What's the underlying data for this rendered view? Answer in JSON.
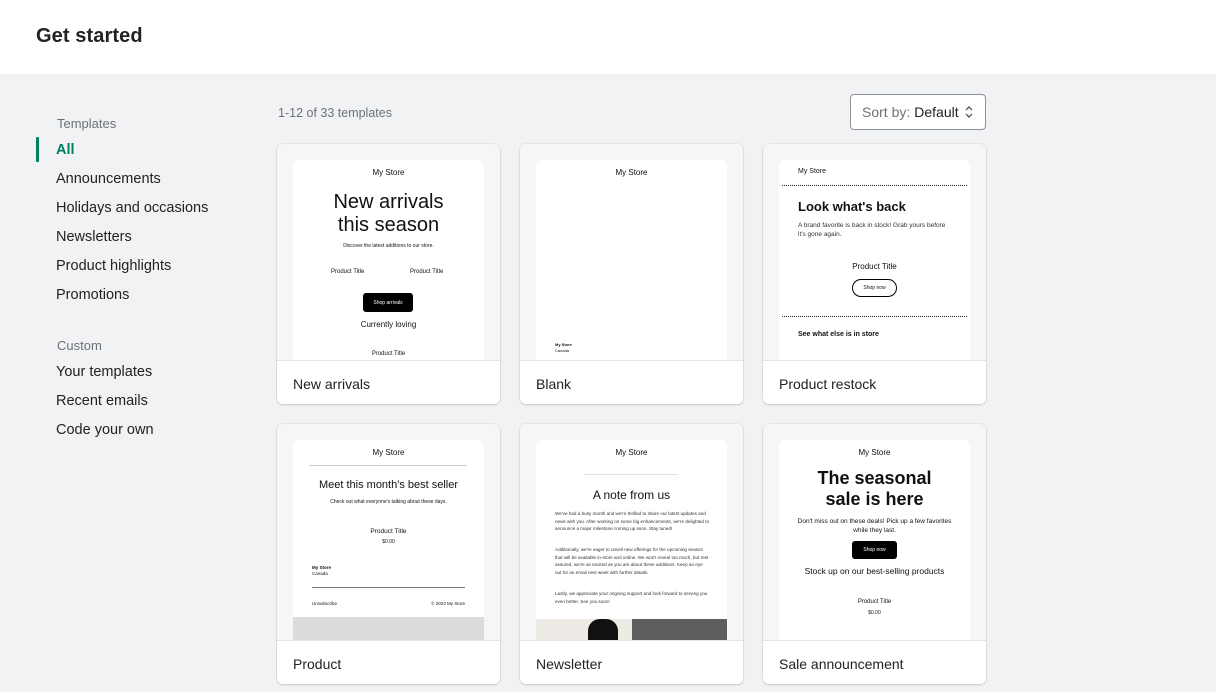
{
  "header": {
    "title": "Get started"
  },
  "sidebar": {
    "templates_label": "Templates",
    "templates": [
      {
        "label": "All",
        "active": true
      },
      {
        "label": "Announcements"
      },
      {
        "label": "Holidays and occasions"
      },
      {
        "label": "Newsletters"
      },
      {
        "label": "Product highlights"
      },
      {
        "label": "Promotions"
      }
    ],
    "custom_label": "Custom",
    "custom": [
      {
        "label": "Your templates"
      },
      {
        "label": "Recent emails"
      },
      {
        "label": "Code your own"
      }
    ]
  },
  "toolbar": {
    "count": "1-12 of 33 templates",
    "sort_prefix": "Sort by:",
    "sort_value": "Default"
  },
  "colors": {
    "accent": "#008060",
    "background": "#f1f2f4"
  },
  "cards": [
    {
      "name": "New arrivals",
      "preview": {
        "store": "My Store",
        "headline_1": "New arrivals",
        "headline_2": "this season",
        "sub": "Discover the latest additions to our store.",
        "product_1": "Product Title",
        "product_2": "Product Title",
        "button": "Shop arrivals",
        "section": "Currently loving",
        "product_3": "Product Title"
      }
    },
    {
      "name": "Blank",
      "preview": {
        "store": "My Store",
        "footer_store": "My Store",
        "footer_country": "Canada"
      }
    },
    {
      "name": "Product restock",
      "preview": {
        "store": "My Store",
        "headline": "Look what's back",
        "body": "A brand favorite is back in stock! Grab yours before it's gone again.",
        "product": "Product Title",
        "button": "Shop now",
        "section": "See what else is in store"
      }
    },
    {
      "name": "Product",
      "preview": {
        "store": "My Store",
        "headline": "Meet this month's best seller",
        "sub": "Check out what everyone's talking about these days.",
        "product": "Product Title",
        "price": "$0.00",
        "footer_store": "My Store",
        "footer_country": "Canada",
        "unsubscribe": "Unsubscribe",
        "copyright": "© 2023 My Store"
      }
    },
    {
      "name": "Newsletter",
      "preview": {
        "store": "My Store",
        "headline": "A note from us",
        "para_1": "We've had a busy month and we're thrilled to share our latest updates and news with you. After working on some big enhancements, we're delighted to announce a major milestone coming up soon. Stay tuned!",
        "para_2": "Additionally, we're eager to unveil new offerings for the upcoming season that will be available in-store and online. We won't reveal too much, but rest assured, we're as excited as you are about these additions. Keep an eye out for an email next week with further details.",
        "para_3": "Lastly, we appreciate your ongoing support and look forward to serving you even better. See you soon!"
      }
    },
    {
      "name": "Sale announcement",
      "preview": {
        "store": "My Store",
        "headline_1": "The seasonal",
        "headline_2": "sale is here",
        "sub": "Don't miss out on these deals! Pick up a few favorites while they last.",
        "button": "Shop now",
        "section": "Stock up on our best-selling products",
        "product": "Product Title",
        "price": "$0.00"
      }
    }
  ]
}
